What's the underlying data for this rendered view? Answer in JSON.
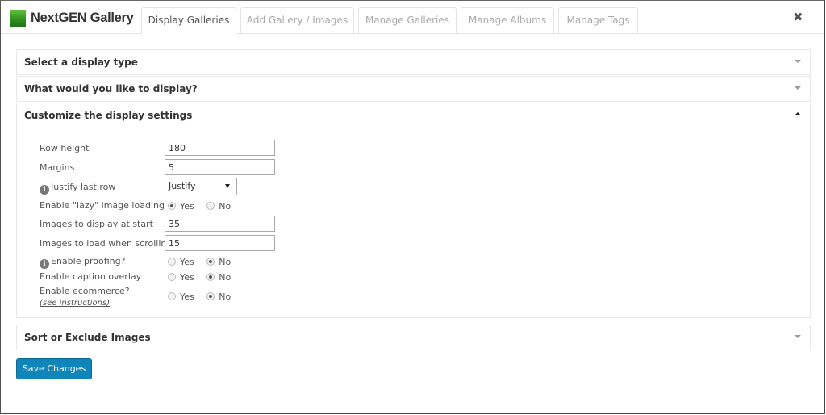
{
  "header": {
    "brand": "NextGEN Gallery",
    "tabs": [
      {
        "label": "Display Galleries",
        "active": true
      },
      {
        "label": "Add Gallery / Images",
        "active": false
      },
      {
        "label": "Manage Galleries",
        "active": false
      },
      {
        "label": "Manage Albums",
        "active": false
      },
      {
        "label": "Manage Tags",
        "active": false
      }
    ],
    "close_icon": "close-icon (✖)"
  },
  "sections": [
    {
      "title": "Select a display type",
      "expanded": false
    },
    {
      "title": "What would you like to display?",
      "expanded": false
    },
    {
      "title": "Customize the display settings",
      "expanded": true
    },
    {
      "title": "Sort or Exclude Images",
      "expanded": false
    }
  ],
  "settings": {
    "row_height": {
      "label": "Row height",
      "value": "180"
    },
    "margins": {
      "label": "Margins",
      "value": "5"
    },
    "justify_last_row": {
      "label": "Justify last row",
      "selected": "Justify",
      "info_icon": "info-icon"
    },
    "lazy_loading": {
      "label": "Enable \"lazy\" image loading",
      "yes": "Yes",
      "no": "No",
      "value": "Yes"
    },
    "images_at_start": {
      "label": "Images to display at start",
      "value": "35"
    },
    "images_scrolling": {
      "label": "Images to load when scrolling",
      "value": "15"
    },
    "proofing": {
      "label": "Enable proofing?",
      "yes": "Yes",
      "no": "No",
      "value": "No",
      "info_icon": "info-icon"
    },
    "caption_overlay": {
      "label": "Enable caption overlay",
      "yes": "Yes",
      "no": "No",
      "value": "No"
    },
    "ecommerce": {
      "label": "Enable ecommerce?",
      "link": "(see instructions)",
      "yes": "Yes",
      "no": "No",
      "value": "No"
    }
  },
  "actions": {
    "save_label": "Save Changes"
  },
  "colors": {
    "accent": "#0f85b9",
    "logo_green": "#2e8f1f"
  }
}
